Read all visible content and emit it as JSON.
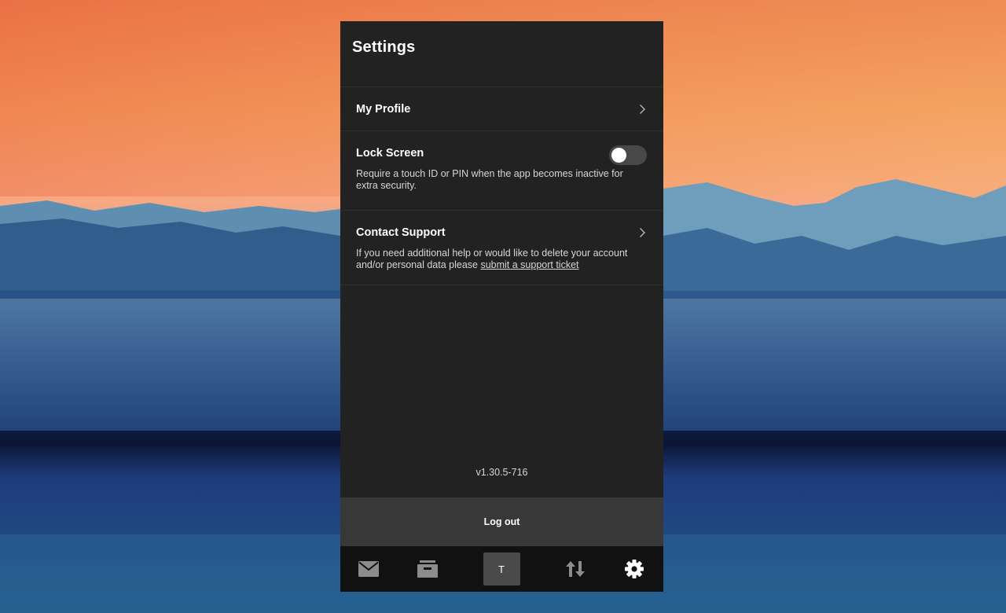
{
  "header": {
    "title": "Settings"
  },
  "settings": {
    "profile": {
      "label": "My Profile"
    },
    "lock": {
      "label": "Lock Screen",
      "description": "Require a touch ID or PIN when the app becomes inactive for extra security.",
      "enabled": false
    },
    "support": {
      "label": "Contact Support",
      "description_prefix": "If you need additional help or would like to delete your account and/or personal data please ",
      "link_text": "submit a support ticket"
    }
  },
  "footer": {
    "version": "v1.30.5-716",
    "logout_label": "Log out"
  },
  "tabbar": {
    "items": [
      {
        "icon": "mail-icon",
        "active": false
      },
      {
        "icon": "archive-icon",
        "active": false
      },
      {
        "icon": "avatar",
        "initial": "T",
        "active": false
      },
      {
        "icon": "transfer-icon",
        "active": false
      },
      {
        "icon": "gear-icon",
        "active": true
      }
    ]
  },
  "colors": {
    "panel": "#222222",
    "logout_bg": "#383838",
    "tabbar_bg": "#111111",
    "icon_inactive": "#8c8c8c",
    "icon_active": "#ffffff"
  }
}
